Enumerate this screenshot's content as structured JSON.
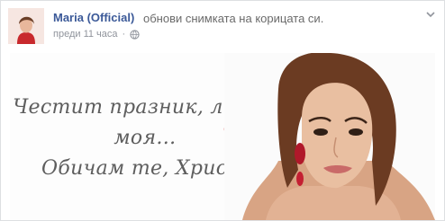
{
  "post": {
    "author": "Maria (Official)",
    "action": "обнови снимката на корицата си.",
    "timestamp": "преди 11 часа",
    "separator": "·",
    "privacy_icon": "globe-icon",
    "menu_icon": "chevron-down-icon"
  },
  "cover": {
    "line1": "Честит празник, любов моя…",
    "line2": "Обичам те, Хриси!",
    "heart_icon": "heart-icon",
    "heart_color": "#d9322b"
  },
  "colors": {
    "author_link": "#3b5998",
    "meta_text": "#90949c",
    "border": "#dddfe2"
  }
}
